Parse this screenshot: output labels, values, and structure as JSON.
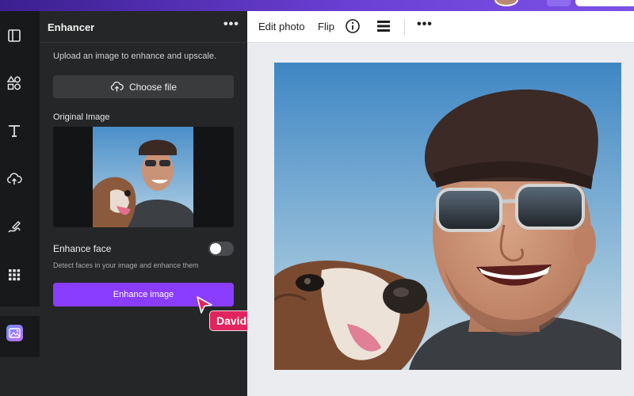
{
  "panel": {
    "title": "Enhancer",
    "more_label": "•••",
    "description": "Upload an image to enhance and upscale.",
    "choose_file_label": "Choose file",
    "original_image_label": "Original Image",
    "enhance_face_label": "Enhance face",
    "enhance_face_on": false,
    "enhance_face_description": "Detect faces in your image and enhance them",
    "enhance_button_label": "Enhance image"
  },
  "toolbar": {
    "edit_photo_label": "Edit photo",
    "flip_label": "Flip",
    "more_label": "•••"
  },
  "cursor": {
    "user_name": "David"
  },
  "rail": {
    "icons": [
      "templates-icon",
      "elements-icon",
      "text-icon",
      "uploads-icon",
      "draw-icon",
      "apps-icon",
      "enhancer-app-icon"
    ]
  },
  "colors": {
    "accent": "#8b3dff",
    "cursor_tag": "#e0245e",
    "panel_bg": "#252627",
    "rail_bg": "#18191b"
  }
}
